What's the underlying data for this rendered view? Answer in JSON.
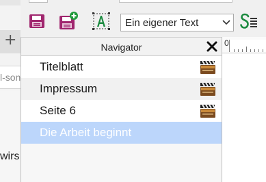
{
  "background_app": {
    "tab_plus": "+",
    "url_fragment": "l-son",
    "content_fragment": "wirs"
  },
  "toolbar": {
    "buttons": [
      {
        "name": "save-icon"
      },
      {
        "name": "save-as-icon"
      },
      {
        "name": "text-style-icon"
      },
      {
        "name": "style-list-icon"
      }
    ],
    "style_select": {
      "value": "Ein eigener Text"
    }
  },
  "navigator": {
    "title": "Navigator",
    "items": [
      {
        "label": "Titelblatt",
        "icon": "clapperboard-icon",
        "selected": false
      },
      {
        "label": "Impressum",
        "icon": "clapperboard-icon",
        "selected": false
      },
      {
        "label": "Seite 6",
        "icon": "clapperboard-icon",
        "selected": false
      },
      {
        "label": "Die Arbeit beginnt",
        "icon": "",
        "selected": true
      }
    ]
  },
  "ruler": {
    "zero_label": "0"
  },
  "colors": {
    "selection": "#bcd6fb",
    "save_magenta": "#a0266e",
    "add_green": "#1f9a3a",
    "style_green": "#1b8a3f"
  }
}
